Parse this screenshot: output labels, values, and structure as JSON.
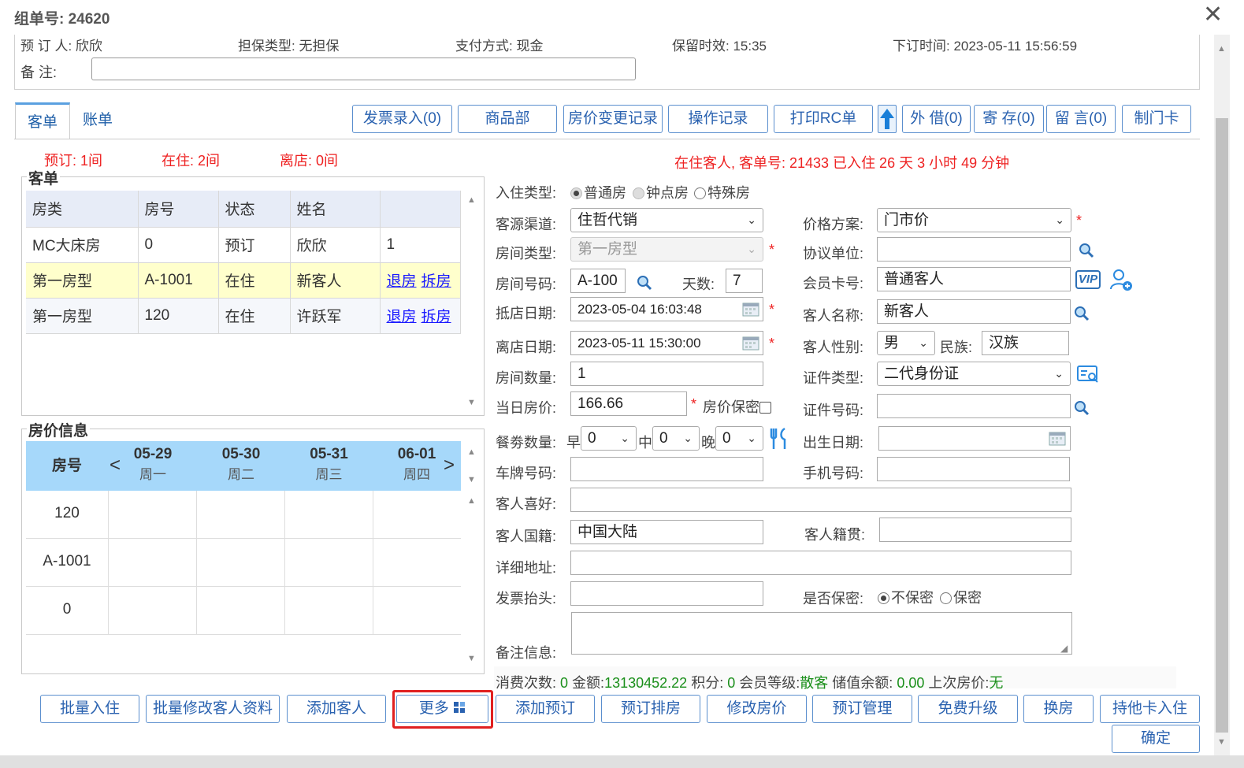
{
  "window": {
    "title": "组单号: 24620"
  },
  "info": {
    "booker": "预 订 人: 欣欣",
    "guarantee": "担保类型: 无担保",
    "payment": "支付方式: 现金",
    "retention": "保留时效: 15:35",
    "booked_time": "下订时间: 2023-05-11 15:56:59",
    "remark_label": "备 注:",
    "remark_value": ""
  },
  "tabs": [
    {
      "label": "客单"
    },
    {
      "label": "账单"
    }
  ],
  "toolbar": {
    "invoice": "发票录入(0)",
    "goods": "商品部",
    "price_log": "房价变更记录",
    "op_log": "操作记录",
    "print_rc": "打印RC单",
    "borrow": "外 借(0)",
    "deposit": "寄 存(0)",
    "message": "留 言(0)",
    "door_card": "制门卡"
  },
  "counts": {
    "reserved": "预订: 1间",
    "in_house": "在住: 2间",
    "departed": "离店: 0间"
  },
  "in_house_msg": "在住客人, 客单号: 21433 已入住 26 天 3 小时 49 分钟",
  "guest_list": {
    "legend": "客单",
    "headers": [
      "房类",
      "房号",
      "状态",
      "姓名",
      ""
    ],
    "rows": [
      {
        "type": "MC大床房",
        "room": "0",
        "status": "预订",
        "name": "欣欣",
        "extra": "1"
      },
      {
        "type": "第一房型",
        "room": "A-1001",
        "status": "在住",
        "name": "新客人",
        "checkout": "退房",
        "split": "拆房"
      },
      {
        "type": "第一房型",
        "room": "120",
        "status": "在住",
        "name": "许跃军",
        "checkout": "退房",
        "split": "拆房"
      }
    ]
  },
  "price_info": {
    "legend": "房价信息",
    "room_header": "房号",
    "prev": "<",
    "next": ">",
    "days": [
      {
        "date": "05-29",
        "week": "周一"
      },
      {
        "date": "05-30",
        "week": "周二"
      },
      {
        "date": "05-31",
        "week": "周三"
      },
      {
        "date": "06-01",
        "week": "周四"
      }
    ],
    "rooms": [
      "120",
      "A-1001",
      "0"
    ]
  },
  "form": {
    "checkin_type_label": "入住类型:",
    "checkin_types": [
      "普通房",
      "钟点房",
      "特殊房"
    ],
    "channel_label": "客源渠道:",
    "channel_value": "住哲代销",
    "price_plan_label": "价格方案:",
    "price_plan_value": "门市价",
    "room_type_label": "房间类型:",
    "room_type_value": "第一房型",
    "agreement_label": "协议单位:",
    "agreement_value": "",
    "room_no_label": "房间号码:",
    "room_no_value": "A-100",
    "days_label": "天数:",
    "days_value": "7",
    "member_label": "会员卡号:",
    "member_value": "普通客人",
    "vip_text": "VIP",
    "arrive_label": "抵店日期:",
    "arrive_value": "2023-05-04 16:03:48",
    "guest_name_label": "客人名称:",
    "guest_name_value": "新客人",
    "depart_label": "离店日期:",
    "depart_value": "2023-05-11 15:30:00",
    "gender_label": "客人性别:",
    "gender_value": "男",
    "nation_label": "民族:",
    "nation_value": "汉族",
    "room_count_label": "房间数量:",
    "room_count_value": "1",
    "id_type_label": "证件类型:",
    "id_type_value": "二代身份证",
    "rate_label": "当日房价:",
    "rate_value": "166.66",
    "rate_secret_label": "房价保密",
    "id_no_label": "证件号码:",
    "id_no_value": "",
    "meal_label": "餐劵数量:",
    "breakfast": "早",
    "lunch": "中",
    "dinner": "晚",
    "breakfast_value": "0",
    "lunch_value": "0",
    "dinner_value": "0",
    "birth_label": "出生日期:",
    "birth_value": "",
    "plate_label": "车牌号码:",
    "plate_value": "",
    "phone_label": "手机号码:",
    "phone_value": "",
    "hobby_label": "客人喜好:",
    "hobby_value": "",
    "nationality_label": "客人国籍:",
    "nationality_value": "中国大陆",
    "native_label": "客人籍贯:",
    "native_value": "",
    "address_label": "详细地址:",
    "address_value": "",
    "invoice_title_label": "发票抬头:",
    "invoice_title_value": "",
    "secret_label": "是否保密:",
    "secret_options": [
      "不保密",
      "保密"
    ],
    "notes_label": "备注信息:",
    "notes_value": "",
    "required_mark": "*"
  },
  "summary": {
    "visits_label": "消费次数:",
    "visits": "0",
    "amount_label": "金额:",
    "amount": "13130452.22",
    "points_label": "积分:",
    "points": "0",
    "level_label": "会员等级:",
    "level": "散客",
    "balance_label": "储值余额:",
    "balance": "0.00",
    "last_rate_label": "上次房价:",
    "last_rate": "无"
  },
  "bottom": {
    "batch_checkin": "批量入住",
    "batch_edit": "批量修改客人资料",
    "add_guest": "添加客人",
    "more": "更多",
    "add_booking": "添加预订",
    "booking_assign": "预订排房",
    "modify_rate": "修改房价",
    "booking_manage": "预订管理",
    "free_upgrade": "免费升级",
    "change_room": "换房",
    "other_card": "持他卡入住",
    "confirm": "确定"
  },
  "colors": {
    "accent": "#2a62b0",
    "highlight_border": "#e02020",
    "required": "#e22222"
  }
}
